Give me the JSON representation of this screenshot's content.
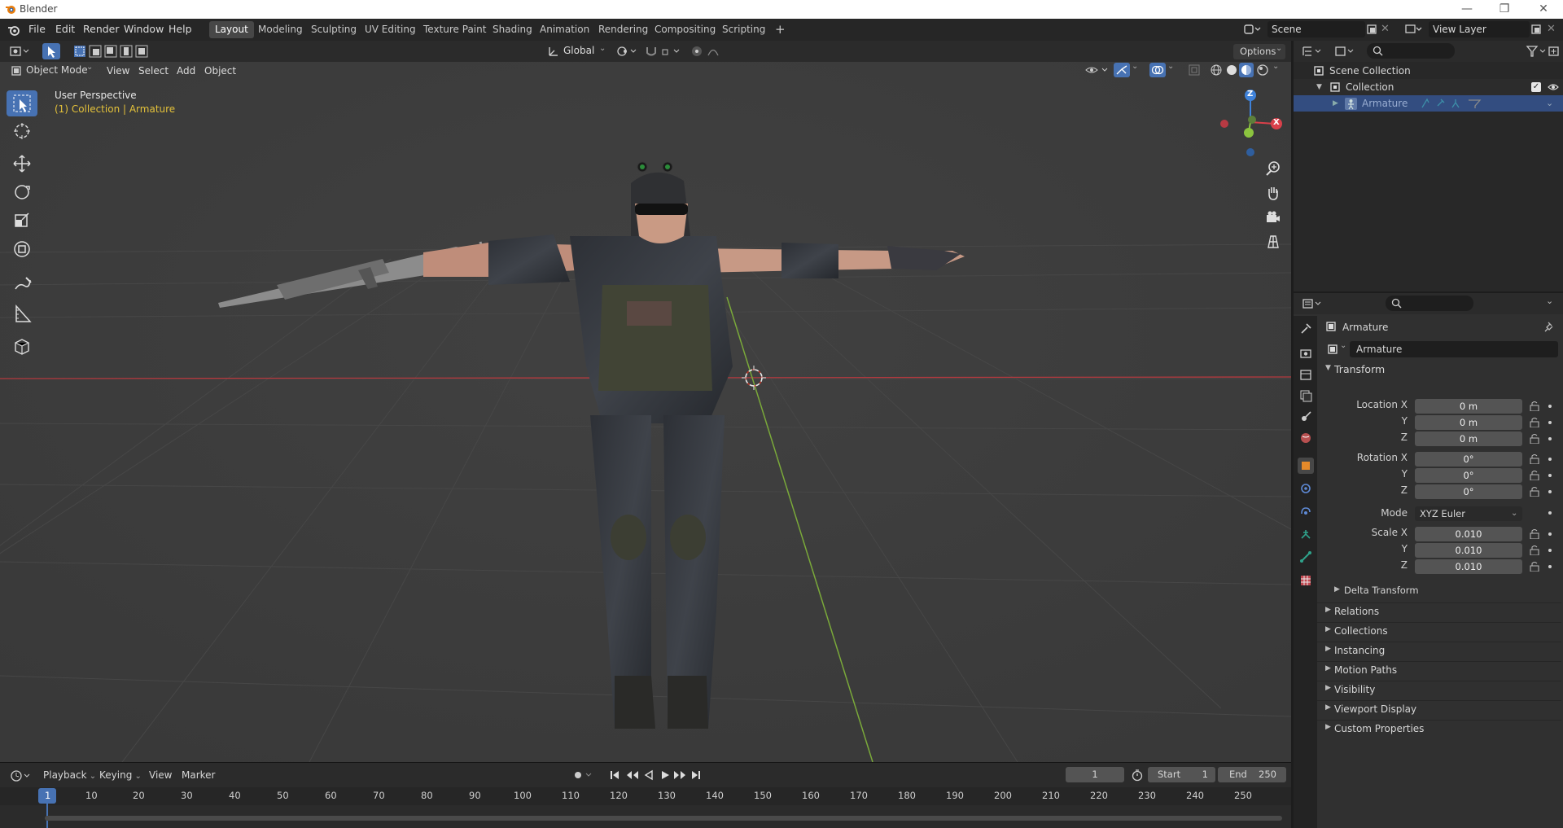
{
  "window": {
    "title": "Blender"
  },
  "menu": [
    "File",
    "Edit",
    "Render",
    "Window",
    "Help"
  ],
  "workspaces": [
    "Layout",
    "Modeling",
    "Sculpting",
    "UV Editing",
    "Texture Paint",
    "Shading",
    "Animation",
    "Rendering",
    "Compositing",
    "Scripting"
  ],
  "active_workspace": "Layout",
  "scene": {
    "name": "Scene",
    "view_layer": "View Layer"
  },
  "viewport": {
    "mode": "Object Mode",
    "header_menus": [
      "View",
      "Select",
      "Add",
      "Object"
    ],
    "transform_orientation": "Global",
    "options_label": "Options",
    "overlay_title": "User Perspective",
    "overlay_subtitle": "(1) Collection | Armature",
    "gizmo": {
      "z": "Z",
      "x": "X"
    }
  },
  "outliner": {
    "root": "Scene Collection",
    "collection": "Collection",
    "object": "Armature"
  },
  "properties": {
    "object_name": "Armature",
    "datablock_name": "Armature",
    "transform_header": "Transform",
    "location_labels": [
      "Location X",
      "Y",
      "Z"
    ],
    "location_values": [
      "0 m",
      "0 m",
      "0 m"
    ],
    "rotation_labels": [
      "Rotation X",
      "Y",
      "Z"
    ],
    "rotation_values": [
      "0°",
      "0°",
      "0°"
    ],
    "mode_label": "Mode",
    "mode_value": "XYZ Euler",
    "scale_labels": [
      "Scale X",
      "Y",
      "Z"
    ],
    "scale_values": [
      "0.010",
      "0.010",
      "0.010"
    ],
    "delta_transform": "Delta Transform",
    "panels": [
      "Relations",
      "Collections",
      "Instancing",
      "Motion Paths",
      "Visibility",
      "Viewport Display",
      "Custom Properties"
    ]
  },
  "timeline": {
    "menus": [
      "Playback",
      "Keying",
      "View",
      "Marker"
    ],
    "current_frame": "1",
    "start_label": "Start",
    "start_value": "1",
    "end_label": "End",
    "end_value": "250",
    "ruler": [
      "1",
      "10",
      "20",
      "30",
      "40",
      "50",
      "60",
      "70",
      "80",
      "90",
      "100",
      "110",
      "120",
      "130",
      "140",
      "150",
      "160",
      "170",
      "180",
      "190",
      "200",
      "210",
      "220",
      "230",
      "240",
      "250"
    ]
  },
  "colors": {
    "accent": "#4772b3",
    "x_axis": "#d9404a",
    "y_axis": "#8cc43f",
    "z_axis": "#3f82d9",
    "overlay_text_yellow": "#e3c13a"
  }
}
